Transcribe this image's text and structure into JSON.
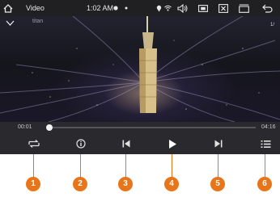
{
  "statusbar": {
    "app_title": "Video",
    "time": "1:02 AM",
    "icons": [
      "home-icon",
      "record-icon",
      "dot-icon",
      "location-icon",
      "wifi-icon",
      "volume-icon",
      "screenshot-icon",
      "close-box-icon",
      "window-icon",
      "back-icon"
    ]
  },
  "video": {
    "overlay_label": "titan",
    "page_indicator": "1/"
  },
  "player": {
    "elapsed": "00:01",
    "duration": "04:16",
    "progress_fraction": 0.01,
    "buttons": [
      "repeat",
      "info",
      "previous",
      "play",
      "next",
      "playlist"
    ]
  },
  "markers": [
    "1",
    "2",
    "3",
    "4",
    "5",
    "6"
  ],
  "colors": {
    "accent": "#e8751a",
    "bar": "#2a2a2e",
    "status": "#202022"
  }
}
